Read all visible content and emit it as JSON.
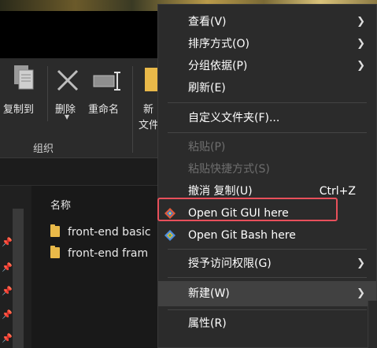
{
  "ribbon": {
    "copy_to": "复制到",
    "delete": "删除",
    "rename": "重命名",
    "new_partial_top": "新",
    "new_partial_bottom": "文件",
    "group_label": "组织"
  },
  "file_list": {
    "column_name": "名称",
    "rows": [
      {
        "name": "front-end basic"
      },
      {
        "name": "front-end fram"
      }
    ]
  },
  "context_menu": {
    "items": [
      {
        "label": "查看(V)",
        "submenu": true
      },
      {
        "label": "排序方式(O)",
        "submenu": true
      },
      {
        "label": "分组依据(P)",
        "submenu": true
      },
      {
        "label": "刷新(E)"
      },
      {
        "label": "自定义文件夹(F)..."
      },
      {
        "label": "粘贴(P)",
        "disabled": true
      },
      {
        "label": "粘贴快捷方式(S)",
        "disabled": true
      },
      {
        "label": "撤消 复制(U)",
        "shortcut": "Ctrl+Z"
      },
      {
        "label": "Open Git GUI here",
        "icon": "git-gui-icon"
      },
      {
        "label": "Open Git Bash here",
        "icon": "git-bash-icon"
      },
      {
        "label": "授予访问权限(G)",
        "submenu": true
      },
      {
        "label": "新建(W)",
        "submenu": true,
        "hovered": true
      },
      {
        "label": "属性(R)"
      }
    ]
  },
  "colors": {
    "menu_bg": "#2b2b2b",
    "highlight_border": "#e8505b",
    "folder": "#e9b949"
  }
}
